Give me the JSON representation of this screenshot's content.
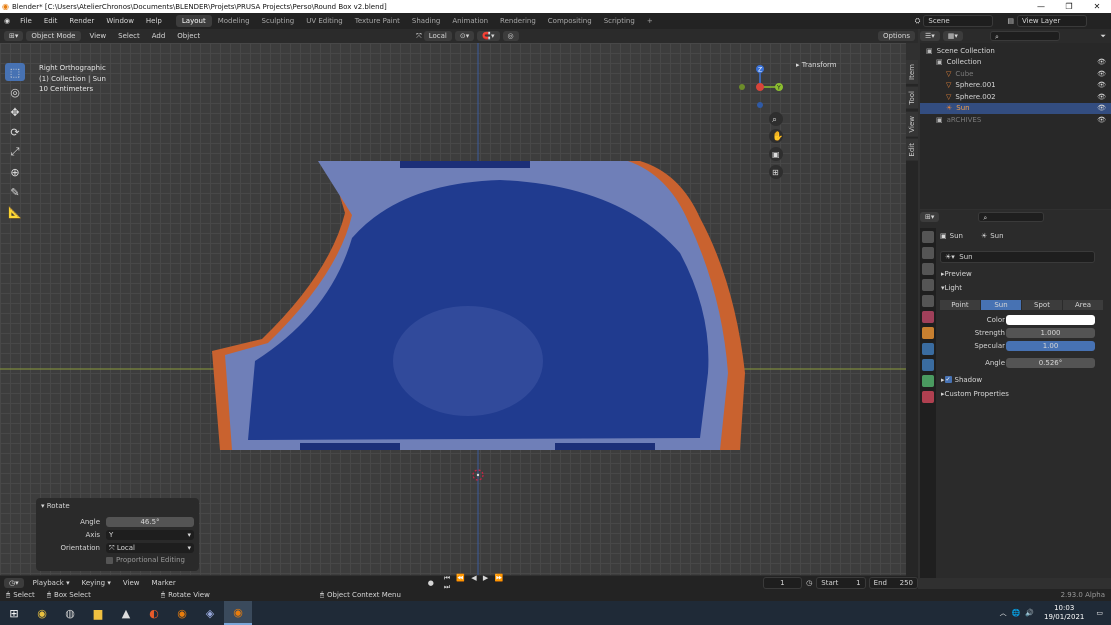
{
  "titlebar": {
    "title": "Blender* [C:\\Users\\AtelierChronos\\Documents\\BLENDER\\Projets\\PRUSA Projects\\Perso\\Round Box v2.blend]",
    "min": "—",
    "max": "❐",
    "close": "✕"
  },
  "menus": [
    "File",
    "Edit",
    "Render",
    "Window",
    "Help"
  ],
  "workspaces": [
    "Layout",
    "Modeling",
    "Sculpting",
    "UV Editing",
    "Texture Paint",
    "Shading",
    "Animation",
    "Rendering",
    "Compositing",
    "Scripting"
  ],
  "scene": "Scene",
  "viewlayer": "View Layer",
  "header3d": {
    "mode": "Object Mode",
    "view": "View",
    "select": "Select",
    "add": "Add",
    "object": "Object",
    "orientation": "Local",
    "options": "Options"
  },
  "viewport": {
    "line1": "Right Orthographic",
    "line2": "(1) Collection | Sun",
    "line3": "10 Centimeters"
  },
  "gizmo": {
    "z": "Z",
    "y": "Y"
  },
  "sidebar": {
    "transform": "Transform",
    "tabs": [
      "Item",
      "Tool",
      "View",
      "Edit"
    ]
  },
  "outliner": {
    "rows": [
      {
        "label": "Scene Collection",
        "indent": 0,
        "dim": false,
        "sel": false
      },
      {
        "label": "Collection",
        "indent": 1,
        "dim": false,
        "sel": false
      },
      {
        "label": "Cube",
        "indent": 2,
        "dim": true,
        "sel": false
      },
      {
        "label": "Sphere.001",
        "indent": 2,
        "dim": false,
        "sel": false
      },
      {
        "label": "Sphere.002",
        "indent": 2,
        "dim": false,
        "sel": false
      },
      {
        "label": "Sun",
        "indent": 2,
        "dim": false,
        "sel": true
      },
      {
        "label": "aRCHIVES",
        "indent": 1,
        "dim": true,
        "sel": false
      }
    ]
  },
  "props": {
    "crumb1": "Sun",
    "crumb2": "Sun",
    "datablock": "Sun",
    "preview": "Preview",
    "light": "Light",
    "types": [
      "Point",
      "Sun",
      "Spot",
      "Area"
    ],
    "active_type": "Sun",
    "color_label": "Color",
    "strength_label": "Strength",
    "strength": "1.000",
    "specular_label": "Specular",
    "specular": "1.00",
    "angle_label": "Angle",
    "angle": "0.526°",
    "shadow": "Shadow",
    "custom": "Custom Properties"
  },
  "rotate": {
    "title": "Rotate",
    "angle_label": "Angle",
    "angle": "46.5°",
    "axis_label": "Axis",
    "axis": "Y",
    "orient_label": "Orientation",
    "orient": "Local",
    "prop_edit": "Proportional Editing"
  },
  "timeline": {
    "playback": "Playback",
    "keying": "Keying",
    "view": "View",
    "marker": "Marker",
    "frame": "1",
    "start_label": "Start",
    "start": "1",
    "end_label": "End",
    "end": "250"
  },
  "status": {
    "select": "Select",
    "box": "Box Select",
    "rotate": "Rotate View",
    "ctx": "Object Context Menu",
    "version": "2.93.0 Alpha"
  },
  "taskbar": {
    "time": "10:03",
    "date": "19/01/2021"
  },
  "colors": {
    "accent": "#4772b3",
    "mesh_blue": "#1f3a8c",
    "shell": "#6f7fb8",
    "orange": "#c9622f"
  }
}
